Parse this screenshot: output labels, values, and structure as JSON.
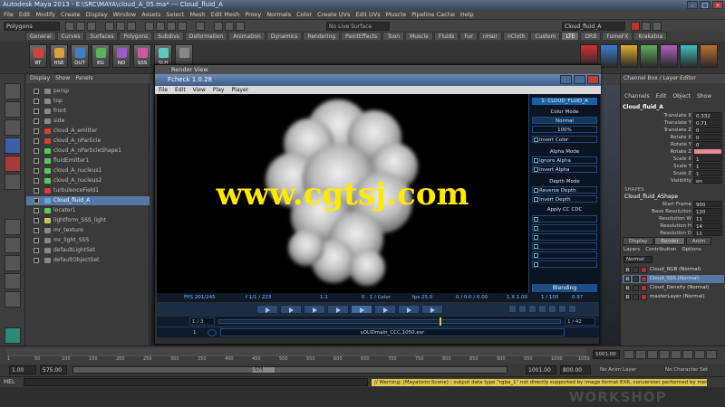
{
  "window": {
    "title": "Autodesk Maya 2013 - E:\\SRC\\MAYA\\cloud_A_05.ma* --- Cloud_fluid_A"
  },
  "maya_menu": [
    "File",
    "Edit",
    "Modify",
    "Create",
    "Display",
    "Window",
    "Assets",
    "Select",
    "Mesh",
    "Edit Mesh",
    "Proxy",
    "Normals",
    "Color",
    "Create UVs",
    "Edit UVs",
    "Muscle",
    "Pipeline Cache",
    "Help"
  ],
  "statusline": {
    "mode": "Polygons",
    "quick_input": "No Live Surface",
    "object_field": "Cloud_fluid_A"
  },
  "shelf_tabs": [
    {
      "label": "General",
      "active": false
    },
    {
      "label": "Curves",
      "active": false
    },
    {
      "label": "Surfaces",
      "active": false
    },
    {
      "label": "Polygons",
      "active": false
    },
    {
      "label": "Subdivs",
      "active": false
    },
    {
      "label": "Deformation",
      "active": false
    },
    {
      "label": "Animation",
      "active": false
    },
    {
      "label": "Dynamics",
      "active": false
    },
    {
      "label": "Rendering",
      "active": false
    },
    {
      "label": "PaintEffects",
      "active": false
    },
    {
      "label": "Toon",
      "active": false
    },
    {
      "label": "Muscle",
      "active": false
    },
    {
      "label": "Fluids",
      "active": false
    },
    {
      "label": "Fur",
      "active": false
    },
    {
      "label": "nHair",
      "active": false
    },
    {
      "label": "nCloth",
      "active": false
    },
    {
      "label": "Custom",
      "active": false
    },
    {
      "label": "LTE",
      "active": true
    },
    {
      "label": "DRB",
      "active": false
    },
    {
      "label": "FumeFX",
      "active": false
    },
    {
      "label": "Krakatoa",
      "active": false
    }
  ],
  "shelf_buttons": [
    {
      "label": "RT",
      "color": "#c9463d"
    },
    {
      "label": "HSE",
      "color": "#d9a13b"
    },
    {
      "label": "OUT",
      "color": "#3d7fc9"
    },
    {
      "label": "EG",
      "color": "#5bb35b"
    },
    {
      "label": "NO",
      "color": "#9c5bc9"
    },
    {
      "label": "SSS",
      "color": "#c95b9c"
    },
    {
      "label": "SLH",
      "color": "#5bc9c0"
    },
    {
      "label": "",
      "color": "#888"
    }
  ],
  "outliner": {
    "menu": [
      "Display",
      "Show",
      "Panels"
    ],
    "rows": [
      {
        "label": "persp",
        "color": "#888",
        "selected": false
      },
      {
        "label": "top",
        "color": "#888",
        "selected": false
      },
      {
        "label": "front",
        "color": "#888",
        "selected": false
      },
      {
        "label": "side",
        "color": "#888",
        "selected": false
      },
      {
        "label": "cloud_A_emitter",
        "color": "#d04040",
        "selected": false
      },
      {
        "label": "cloud_A_nParticle",
        "color": "#d04040",
        "selected": false
      },
      {
        "label": "cloud_A_nParticleShape1",
        "color": "#5cc85c",
        "selected": false
      },
      {
        "label": "fluidEmitter1",
        "color": "#5cc85c",
        "selected": false
      },
      {
        "label": "cloud_A_nucleus1",
        "color": "#5cc85c",
        "selected": false
      },
      {
        "label": "cloud_A_nucleus2",
        "color": "#5cc85c",
        "selected": false
      },
      {
        "label": "turbulenceField1",
        "color": "#d04040",
        "selected": false
      },
      {
        "label": "Cloud_fluid_A",
        "color": "#6fa0e0",
        "selected": true
      },
      {
        "label": "locator1",
        "color": "#5cc85c",
        "selected": false
      },
      {
        "label": "lightform_SSS_light",
        "color": "#c8c85c",
        "selected": false
      },
      {
        "label": "mr_texture",
        "color": "#888",
        "selected": false
      },
      {
        "label": "mr_light_SSS",
        "color": "#888",
        "selected": false
      },
      {
        "label": "defaultLightSet",
        "color": "#888",
        "selected": false
      },
      {
        "label": "defaultObjectSet",
        "color": "#888",
        "selected": false
      }
    ]
  },
  "render_view": {
    "outer_title": "Render View",
    "title": "Fcheck 1.0.28",
    "menu": [
      "File",
      "Edit",
      "View",
      "Play",
      "Player"
    ],
    "watermark": "www.cgtsj.com",
    "panel": {
      "header": "1: CLOUD_FLUID_A",
      "color_mode": "Color Mode",
      "color_mode_value": "Normal",
      "percent": "100%",
      "invert_color": "Invert Color",
      "alpha_mode": "Alpha Mode",
      "ignore_alpha": "Ignore Alpha",
      "invert_alpha": "Invert Alpha",
      "depth_mode": "Depth Mode",
      "ignore_depth": "Reverse Depth",
      "invert_depth": "Invert Depth",
      "apply_ccc": "Apply CC CDC",
      "blending": "Blending"
    },
    "info_bar": [
      "FPS 201/245",
      "f 1/1 / 223",
      "1:1",
      "0 . 1 / Color",
      "fps 25.0",
      "0 / 0.0 / 0.00",
      "1 X 1.00",
      "1 / 100",
      "0.97"
    ],
    "timeline_start": "1 / 3",
    "timeline_end": "1 / 42",
    "bottom_label": "sOLIDmain_CCC.1050.exr",
    "frame_field": "1"
  },
  "channel_box": {
    "tabs": [
      "Channels",
      "Edit",
      "Object",
      "Show"
    ],
    "object": "Cloud_fluid_A",
    "attrs": [
      {
        "name": "Translate X",
        "value": "0.332",
        "hl": false
      },
      {
        "name": "Translate Y",
        "value": "0.71",
        "hl": false
      },
      {
        "name": "Translate Z",
        "value": "0",
        "hl": false
      },
      {
        "name": "Rotate X",
        "value": "0",
        "hl": false
      },
      {
        "name": "Rotate Y",
        "value": "0",
        "hl": false
      },
      {
        "name": "Rotate Z",
        "value": "",
        "hl": true
      },
      {
        "name": "Scale X",
        "value": "1",
        "hl": false
      },
      {
        "name": "Scale Y",
        "value": "1",
        "hl": false
      },
      {
        "name": "Scale Z",
        "value": "1",
        "hl": false
      },
      {
        "name": "Visibility",
        "value": "on",
        "hl": false
      }
    ],
    "shapes_header": "SHAPES",
    "shape_name": "Cloud_fluid_AShape",
    "shape_attrs": [
      {
        "name": "Start Frame",
        "value": "900"
      },
      {
        "name": "Base Resolution",
        "value": "120"
      },
      {
        "name": "Resolution W",
        "value": "11"
      },
      {
        "name": "Resolution H",
        "value": "14"
      },
      {
        "name": "Resolution D",
        "value": "11"
      }
    ],
    "layer_tabs": [
      "Display",
      "Render",
      "Anim"
    ],
    "layer_menu": [
      "Layers",
      "Contribution",
      "Options"
    ],
    "layer_mode": "Normal",
    "layers": [
      {
        "name": "Cloud_RGB (Normal)",
        "selected": false
      },
      {
        "name": "Cloud_SSS (Normal)",
        "selected": true
      },
      {
        "name": "Cloud_Density (Normal)",
        "selected": false
      },
      {
        "name": "masterLayer (Normal)",
        "selected": false
      }
    ]
  },
  "time_slider": {
    "ticks": [
      "1",
      "50",
      "100",
      "150",
      "200",
      "250",
      "300",
      "350",
      "400",
      "450",
      "500",
      "550",
      "600",
      "650",
      "700",
      "750",
      "800",
      "850",
      "900",
      "950",
      "1000",
      "1050"
    ],
    "current": "1001.00"
  },
  "range": {
    "start": "1.00",
    "start2": "575.00",
    "playhead": "575",
    "end": "1001.00",
    "end2": "800.00",
    "anim_layer": "No Anim Layer",
    "char_set": "No Character Set"
  },
  "cmdline": {
    "label": "MEL",
    "warning": "// Warning: (Mayatomr.Scene) : output data type \"rgba_1\" not directly supported by image format EXR, conversion performed by mental ray //"
  },
  "watermark_bottom": "WORKSHOP"
}
